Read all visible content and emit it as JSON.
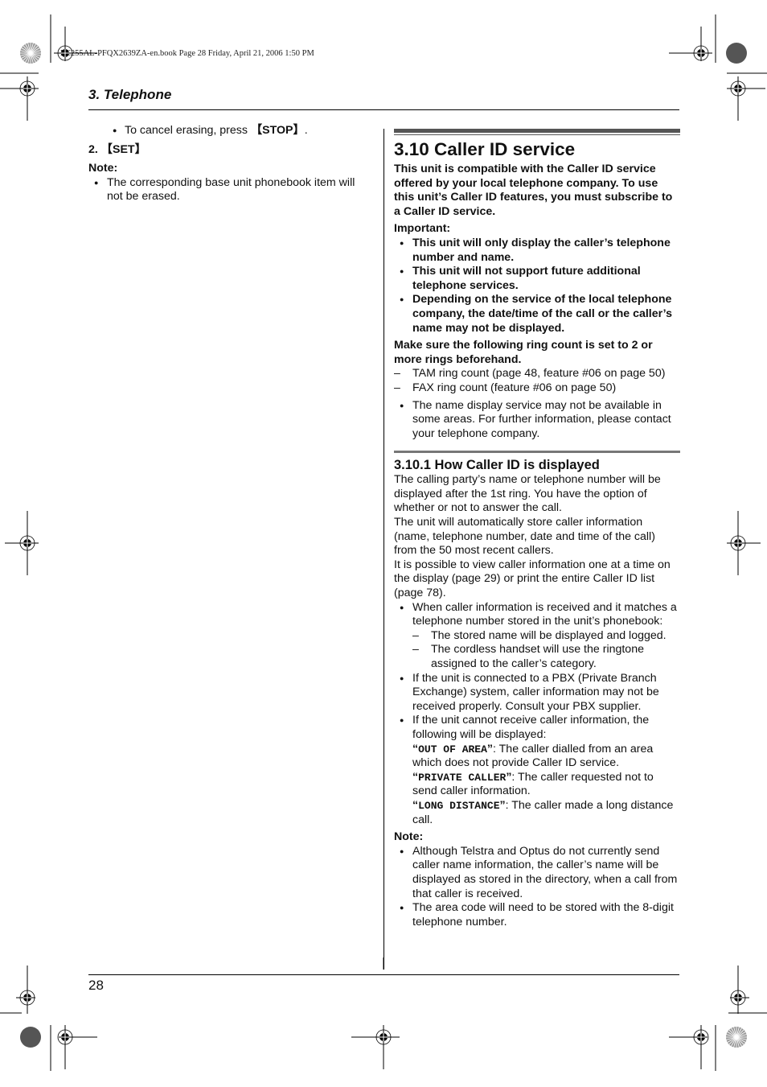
{
  "slug": "FC255AL-PFQX2639ZA-en.book  Page 28  Friday, April 21, 2006  1:50 PM",
  "header": {
    "chapter": "3. Telephone"
  },
  "footer": {
    "page_number": "28"
  },
  "left_column": {
    "bullet_cancel": {
      "prefix": "To cancel erasing, press ",
      "key": "【STOP】",
      "suffix": "."
    },
    "step2": {
      "number": "2.",
      "key": "【SET】"
    },
    "note_label": "Note:",
    "note_items": [
      "The corresponding base unit phonebook item will not be erased."
    ]
  },
  "right_column": {
    "title": "3.10 Caller ID service",
    "intro": "This unit is compatible with the Caller ID service offered by your local telephone company. To use this unit’s Caller ID features, you must subscribe to a Caller ID service.",
    "important_label": "Important:",
    "important_items": [
      "This unit will only display the caller’s telephone number and name.",
      "This unit will not support future additional telephone services.",
      "Depending on the service of the local telephone company, the date/time of the call or the caller’s name may not be displayed."
    ],
    "ring_notice": "Make sure the following ring count is set to 2 or more rings beforehand.",
    "ring_items": [
      "TAM ring count (page 48, feature #06 on page 50)",
      "FAX ring count (feature #06 on page 50)"
    ],
    "name_display_note": "The name display service may not be available in some areas. For further information, please contact your telephone company.",
    "subsection": {
      "title": "3.10.1 How Caller ID is displayed",
      "paragraphs": [
        "The calling party’s name or telephone number will be displayed after the 1st ring. You have the option of whether or not to answer the call.",
        "The unit will automatically store caller information (name, telephone number, date and time of the call) from the 50 most recent callers.",
        "It is possible to view caller information one at a time on the display (page 29) or print the entire Caller ID list (page 78)."
      ],
      "match_bullet": "When caller information is received and it matches a telephone number stored in the unit’s phonebook:",
      "match_subitems": [
        "The stored name will be displayed and logged.",
        "The cordless handset will use the ringtone assigned to the caller’s category."
      ],
      "pbx_bullet": "If the unit is connected to a PBX (Private Branch Exchange) system, caller information may not be received properly. Consult your PBX supplier.",
      "cannot_receive_bullet": "If the unit cannot receive caller information, the following will be displayed:",
      "display_messages": [
        {
          "code": "OUT OF AREA",
          "desc": ": The caller dialled from an area which does not provide Caller ID service."
        },
        {
          "code": "PRIVATE CALLER",
          "desc": ": The caller requested not to send caller information."
        },
        {
          "code": "LONG DISTANCE",
          "desc": ": The caller made a long distance call."
        }
      ],
      "note_label": "Note:",
      "note_items": [
        "Although Telstra and Optus do not currently send caller name information, the caller’s name will be displayed as stored in the directory, when a call from that caller is received.",
        "The area code will need to be stored with the 8-digit telephone number."
      ]
    }
  },
  "print_marks": {
    "registration_mark_icon": "registration-crosshair",
    "color_target_icon": "radial-color-target"
  }
}
